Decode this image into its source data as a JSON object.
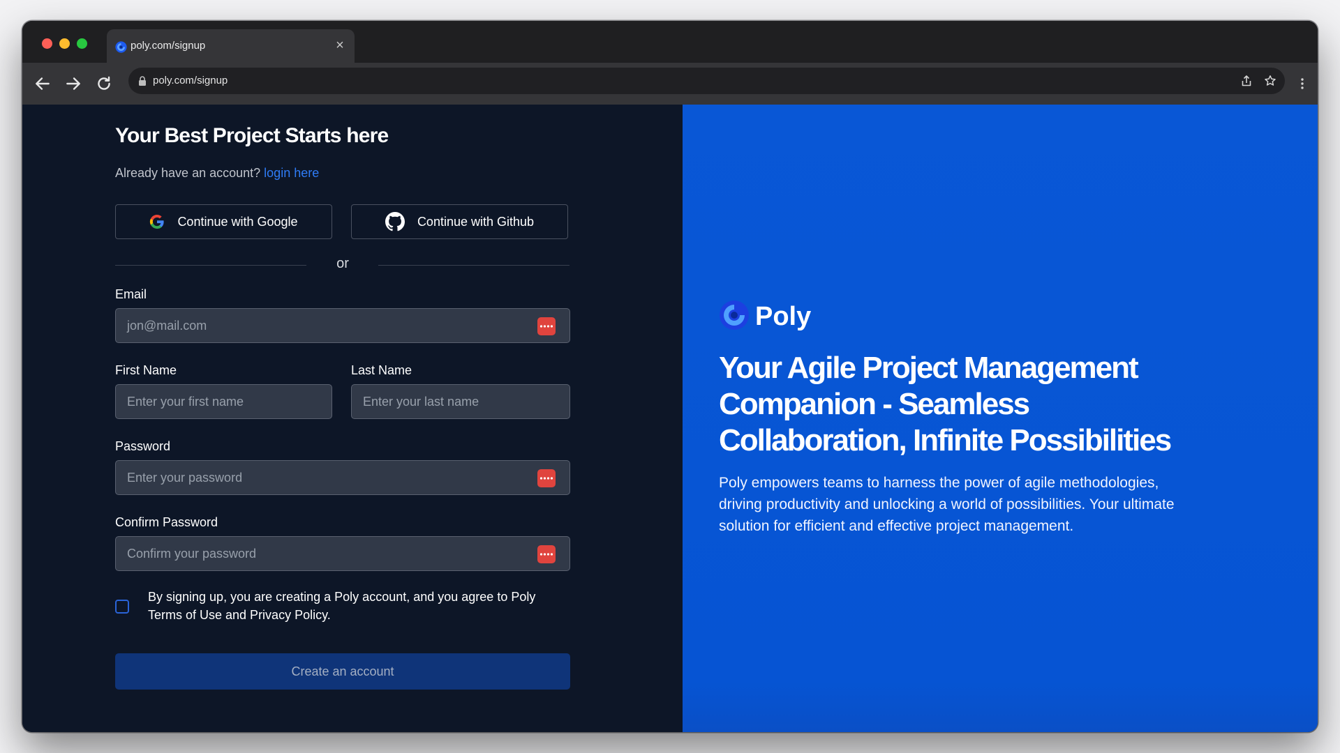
{
  "browser": {
    "tab_title": "poly.com/signup",
    "tab_close": "×",
    "url": "poly.com/signup"
  },
  "signup": {
    "heading": "Your Best Project Starts here",
    "already_text": "Already have an account?",
    "login_link": "login here",
    "google_button": "Continue with Google",
    "github_button": "Continue with Github",
    "divider": "or",
    "email_label": "Email",
    "email_placeholder": "jon@mail.com",
    "first_name_label": "First Name",
    "first_name_placeholder": "Enter your first name",
    "last_name_label": "Last Name",
    "last_name_placeholder": "Enter your last name",
    "password_label": "Password",
    "password_placeholder": "Enter your password",
    "confirm_label": "Confirm Password",
    "confirm_placeholder": "Confirm your password",
    "terms": "By signing up, you are creating a Poly account, and you agree to Poly Terms of Use and Privacy Policy.",
    "terms_checked": false,
    "create_button": "Create an account"
  },
  "hero": {
    "brand": "Poly",
    "tagline": "Your Agile Project Management Companion - Seamless Collaboration, Infinite Possibilities",
    "description": "Poly empowers teams to harness the power of agile methodologies, driving productivity and unlocking a world of possibilities. Your ultimate solution for efficient and effective project management."
  },
  "icons": {
    "favicon": "poly-logo-icon",
    "back": "arrow-left-icon",
    "forward": "arrow-right-icon",
    "reload": "reload-icon",
    "lock": "lock-icon",
    "share": "share-icon",
    "bookmark": "star-icon",
    "menu": "kebab-menu-icon",
    "google": "google-icon",
    "github": "github-icon",
    "password_manager": "password-manager-icon"
  },
  "colors": {
    "form_background": "#0d1627",
    "hero_background": "#0957d6",
    "link": "#2f7cf6",
    "create_button": "#0f3479",
    "password_manager_icon": "#e0443e"
  }
}
